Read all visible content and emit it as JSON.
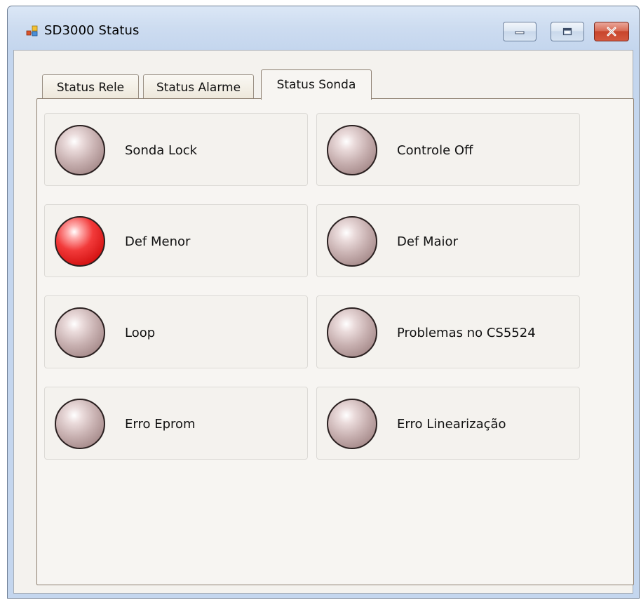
{
  "window": {
    "title": "SD3000 Status"
  },
  "tabs": [
    {
      "label": "Status Rele",
      "selected": false
    },
    {
      "label": "Status Alarme",
      "selected": false
    },
    {
      "label": "Status Sonda",
      "selected": true
    }
  ],
  "indicators": [
    {
      "label": "Sonda Lock",
      "active": false
    },
    {
      "label": "Controle Off",
      "active": false
    },
    {
      "label": "Def Menor",
      "active": true
    },
    {
      "label": "Def Maior",
      "active": false
    },
    {
      "label": "Loop",
      "active": false
    },
    {
      "label": "Problemas no CS5524",
      "active": false
    },
    {
      "label": "Erro Eprom",
      "active": false
    },
    {
      "label": "Erro Linearização",
      "active": false
    }
  ],
  "colors": {
    "led_off": "#c9b2b2",
    "led_on": "#e01515",
    "panel_bg": "#f4f2ee",
    "titlebar": "#cddcf0"
  },
  "icons": {
    "app": "app-icon",
    "minimize": "minimize-icon",
    "maximize": "maximize-icon",
    "close": "close-icon"
  }
}
